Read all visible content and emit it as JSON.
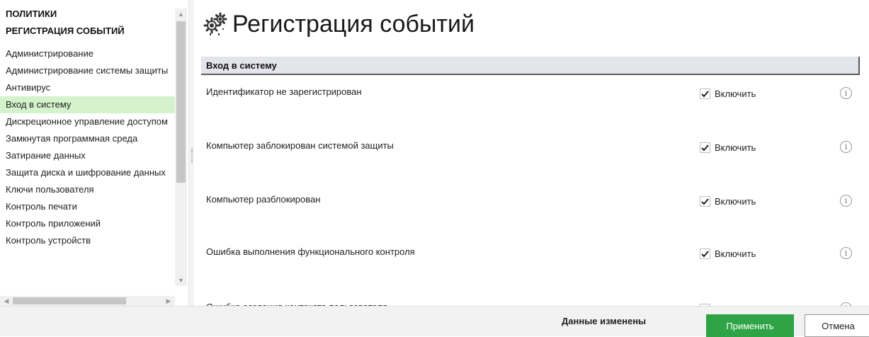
{
  "sidebar": {
    "section1": "ПОЛИТИКИ",
    "section2": "РЕГИСТРАЦИЯ СОБЫТИЙ",
    "items": [
      {
        "label": "Администрирование"
      },
      {
        "label": "Администрирование системы защиты"
      },
      {
        "label": "Антивирус"
      },
      {
        "label": "Вход в систему"
      },
      {
        "label": "Дискреционное управление доступом"
      },
      {
        "label": "Замкнутая программная среда"
      },
      {
        "label": "Затирание данных"
      },
      {
        "label": "Защита диска и шифрование данных"
      },
      {
        "label": "Ключи пользователя"
      },
      {
        "label": "Контроль печати"
      },
      {
        "label": "Контроль приложений"
      },
      {
        "label": "Контроль устройств"
      }
    ],
    "active_index": 3
  },
  "main": {
    "title": "Регистрация событий",
    "title_icon": "gears-icon",
    "group": {
      "title": "Вход в систему",
      "events": [
        {
          "label": "Идентификатор не зарегистрирован",
          "checkbox_label": "Включить",
          "checked": true
        },
        {
          "label": "Компьютер заблокирован системой защиты",
          "checkbox_label": "Включить",
          "checked": true
        },
        {
          "label": "Компьютер разблокирован",
          "checkbox_label": "Включить",
          "checked": true
        },
        {
          "label": "Ошибка выполнения функционального контроля",
          "checkbox_label": "Включить",
          "checked": true
        },
        {
          "label": "Ошибка создания контекста пользователя",
          "checkbox_label": "Включить",
          "checked": true
        }
      ]
    }
  },
  "footer": {
    "status": "Данные изменены",
    "apply_label": "Применить",
    "cancel_label": "Отмена"
  },
  "colors": {
    "accent": "#2ea446",
    "active_item_bg": "#d4f2cc",
    "group_header_bg": "#e4e4ec"
  }
}
